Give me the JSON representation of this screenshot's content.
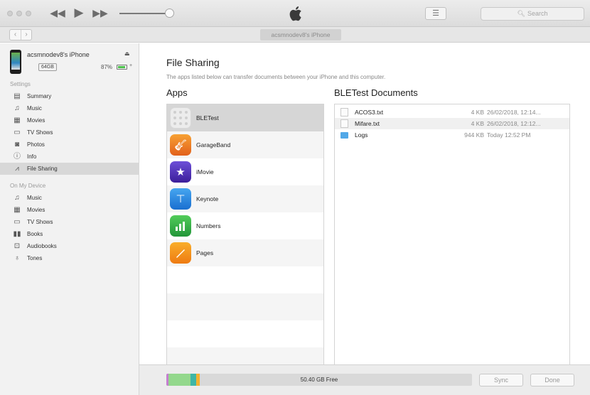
{
  "titlebar": {
    "search_placeholder": "Search",
    "list_view_icon": "list-icon",
    "prev_icon": "rewind-icon",
    "play_icon": "play-icon",
    "next_icon": "fast-forward-icon"
  },
  "navbar": {
    "back_label": "‹",
    "forward_label": "›",
    "device_pill": "acsmnodev8's iPhone"
  },
  "device": {
    "name": "acsmnodev8's iPhone",
    "capacity": "64GB",
    "battery": "87%"
  },
  "sidebar": {
    "settings_label": "Settings",
    "settings_items": [
      {
        "label": "Summary",
        "icon": "summary-icon"
      },
      {
        "label": "Music",
        "icon": "music-icon"
      },
      {
        "label": "Movies",
        "icon": "movies-icon"
      },
      {
        "label": "TV Shows",
        "icon": "tv-icon"
      },
      {
        "label": "Photos",
        "icon": "camera-icon"
      },
      {
        "label": "Info",
        "icon": "info-icon"
      },
      {
        "label": "File Sharing",
        "icon": "file-sharing-icon",
        "selected": true
      }
    ],
    "on_device_label": "On My Device",
    "device_items": [
      {
        "label": "Music",
        "icon": "music-icon"
      },
      {
        "label": "Movies",
        "icon": "movies-icon"
      },
      {
        "label": "TV Shows",
        "icon": "tv-icon"
      },
      {
        "label": "Books",
        "icon": "books-icon"
      },
      {
        "label": "Audiobooks",
        "icon": "audiobooks-icon"
      },
      {
        "label": "Tones",
        "icon": "bell-icon"
      }
    ]
  },
  "main": {
    "title": "File Sharing",
    "description": "The apps listed below can transfer documents between your iPhone and this computer.",
    "apps_heading": "Apps",
    "docs_heading": "BLETest Documents",
    "apps": [
      {
        "name": "BLETest",
        "color": "#ececec",
        "icon": "bletest-app-icon",
        "selected": true
      },
      {
        "name": "GarageBand",
        "color": "#f08a24",
        "icon": "guitar-icon"
      },
      {
        "name": "iMovie",
        "color": "#5a3fc0",
        "icon": "star-icon"
      },
      {
        "name": "Keynote",
        "color": "#2d8ce0",
        "icon": "podium-icon"
      },
      {
        "name": "Numbers",
        "color": "#3bb54a",
        "icon": "bar-chart-icon"
      },
      {
        "name": "Pages",
        "color": "#f39a1d",
        "icon": "pen-icon"
      }
    ],
    "documents": [
      {
        "name": "ACOS3.txt",
        "size": "4 KB",
        "date": "26/02/2018, 12:14...",
        "type": "file"
      },
      {
        "name": "Mifare.txt",
        "size": "4 KB",
        "date": "26/02/2018, 12:12...",
        "type": "file",
        "selected": true
      },
      {
        "name": "Logs",
        "size": "944 KB",
        "date": "Today 12:52 PM",
        "type": "folder"
      }
    ]
  },
  "bottom": {
    "storage_free": "50.40 GB Free",
    "segments": [
      {
        "color": "#c47ed0",
        "fraction": 0.008
      },
      {
        "color": "#93d88c",
        "fraction": 0.07
      },
      {
        "color": "#3fb6a6",
        "fraction": 0.02
      },
      {
        "color": "#f2b232",
        "fraction": 0.012
      }
    ],
    "sync_label": "Sync",
    "done_label": "Done"
  }
}
